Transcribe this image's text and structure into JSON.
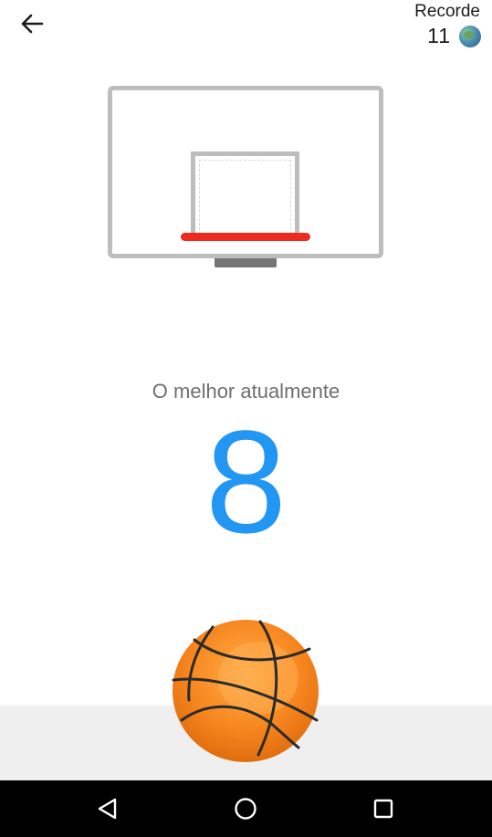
{
  "header": {
    "back_icon": "arrow-left-icon",
    "record_label": "Recorde",
    "record_value": "11",
    "avatar_icon": "user-avatar"
  },
  "game": {
    "best_label": "O melhor atualmente",
    "best_score": "8",
    "score_color": "#2196f3",
    "rim_color": "#ee2a1d",
    "board_color": "#bdbdbd",
    "ball_color": "#f57c00"
  },
  "navigation": {
    "back_icon": "triangle-back-icon",
    "home_icon": "circle-home-icon",
    "recents_icon": "square-recents-icon"
  }
}
